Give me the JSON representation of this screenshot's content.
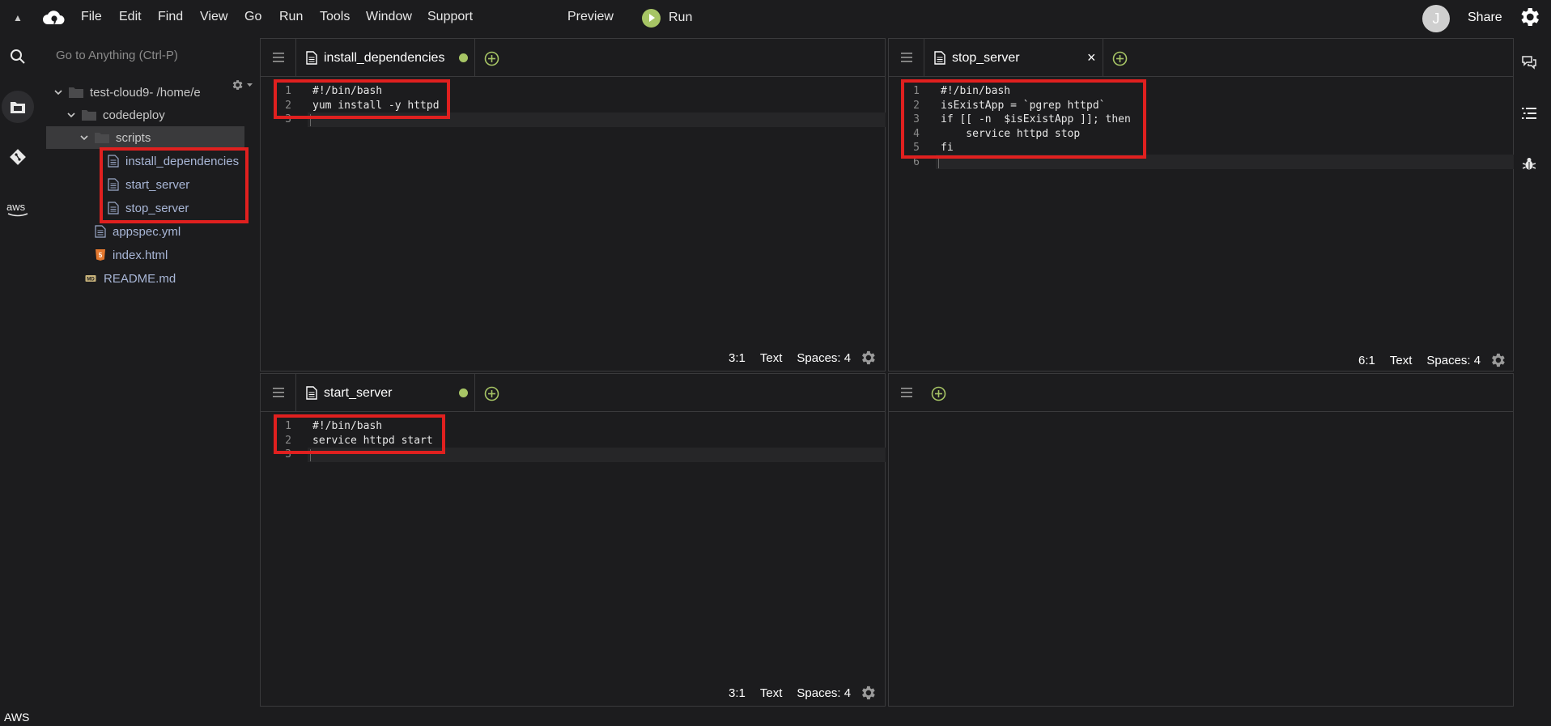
{
  "menubar": {
    "items": [
      "File",
      "Edit",
      "Find",
      "View",
      "Go",
      "Run",
      "Tools",
      "Window",
      "Support"
    ],
    "preview_label": "Preview",
    "run_label": "Run",
    "avatar_initial": "J",
    "share_label": "Share"
  },
  "rail": {
    "icons": [
      "search-icon",
      "files-icon",
      "git-icon",
      "aws-icon"
    ],
    "footer_label": "AWS"
  },
  "tree": {
    "search_placeholder": "Go to Anything (Ctrl-P)",
    "root_label": "test-cloud9",
    "root_path": " - /home/e",
    "items": [
      {
        "label": "codedeploy",
        "type": "folder"
      },
      {
        "label": "scripts",
        "type": "folder"
      },
      {
        "label": "install_dependencies",
        "type": "file"
      },
      {
        "label": "start_server",
        "type": "file"
      },
      {
        "label": "stop_server",
        "type": "file"
      },
      {
        "label": "appspec.yml",
        "type": "file"
      },
      {
        "label": "index.html",
        "type": "html"
      },
      {
        "label": "README.md",
        "type": "markdown"
      }
    ]
  },
  "panes": {
    "install": {
      "tab_label": "install_dependencies",
      "unsaved": true,
      "lines": [
        "#!/bin/bash",
        "yum install -y httpd",
        ""
      ],
      "line_numbers": [
        "1",
        "2",
        "3"
      ],
      "status": {
        "position": "3:1",
        "mode": "Text",
        "spaces": "Spaces: 4"
      }
    },
    "stop": {
      "tab_label": "stop_server",
      "close": "×",
      "lines": [
        "#!/bin/bash",
        "isExistApp = `pgrep httpd`",
        "if [[ -n  $isExistApp ]]; then",
        "    service httpd stop",
        "fi",
        ""
      ],
      "line_numbers": [
        "1",
        "2",
        "3",
        "4",
        "5",
        "6"
      ],
      "status": {
        "position": "6:1",
        "mode": "Text",
        "spaces": "Spaces: 4"
      }
    },
    "start": {
      "tab_label": "start_server",
      "unsaved": true,
      "lines": [
        "#!/bin/bash",
        "service httpd start",
        ""
      ],
      "line_numbers": [
        "1",
        "2",
        "3"
      ],
      "status": {
        "position": "3:1",
        "mode": "Text",
        "spaces": "Spaces: 4"
      }
    }
  },
  "colors": {
    "background": "#1c1c1e",
    "accent_green": "#a7c565",
    "highlight_red": "#e0201f",
    "file_label_blue": "#a8b6d6"
  }
}
